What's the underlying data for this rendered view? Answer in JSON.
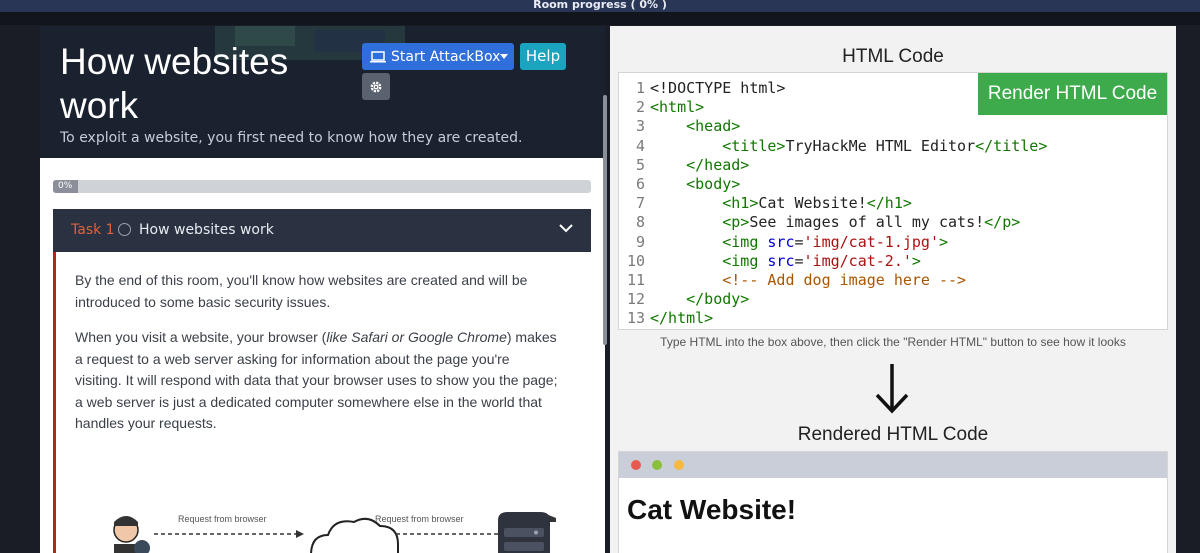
{
  "room": {
    "progress_title": "Room progress ( 0% )"
  },
  "hero": {
    "title": "How websites work",
    "subtitle": "To exploit a website, you first need to know how they are created.",
    "attackbox_label": "Start AttackBox",
    "help_label": "Help"
  },
  "progress": {
    "label": "0%",
    "value": 0
  },
  "task": {
    "number": "Task 1",
    "name": "How websites work",
    "paragraph1": "By the end of this room, you'll know how websites are created and will be introduced to some basic security issues.",
    "p2_before": "When you visit a website, your browser (",
    "p2_italic": "like Safari or Google Chrome",
    "p2_after": ") makes a request to a web server asking for information about the page you're visiting. It will respond with data that your browser uses to show you the page; a web server is just a dedicated computer somewhere else in the world that handles your requests.",
    "diagram_label_1": "Request from browser",
    "diagram_label_2": "Request from browser"
  },
  "editor": {
    "title": "HTML Code",
    "render_label": "Render HTML Code",
    "line_numbers": [
      "1",
      "2",
      "3",
      "4",
      "5",
      "6",
      "7",
      "8",
      "9",
      "10",
      "11",
      "12",
      "13"
    ],
    "hint": "Type HTML into the box above, then click the \"Render HTML\" button to see how it looks"
  },
  "rendered": {
    "title": "Rendered HTML Code",
    "h1": "Cat Website!"
  },
  "colors": {
    "accent_orange": "#e0613a",
    "button_blue": "#2f6fdb",
    "help_teal": "#1aa4c0",
    "render_green": "#3dab4b",
    "task_border_red": "#b3261e"
  }
}
